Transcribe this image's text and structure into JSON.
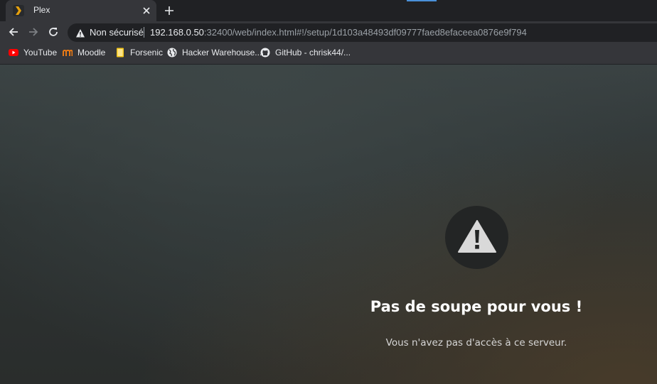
{
  "tab": {
    "title": "Plex",
    "favicon": "plex-chevron-icon",
    "favicon_color": "#e5a00d"
  },
  "toolbar": {
    "back": "back-arrow-icon",
    "forward": "forward-arrow-icon",
    "reload": "reload-icon"
  },
  "omnibox": {
    "security_label": "Non sécurisé",
    "url_host": "192.168.0.50",
    "url_path": ":32400/web/index.html#!/setup/1d103a48493df09777faed8efaceea0876e9f794"
  },
  "bookmarks": [
    {
      "label": "YouTube",
      "icon": "youtube-icon"
    },
    {
      "label": "Moodle",
      "icon": "moodle-icon"
    },
    {
      "label": "Forsenic",
      "icon": "folder-icon"
    },
    {
      "label": "Hacker Warehouse...",
      "icon": "globe-icon"
    },
    {
      "label": "GitHub - chrisk44/...",
      "icon": "github-icon"
    }
  ],
  "page": {
    "icon": "warning-icon",
    "headline": "Pas de soupe pour vous !",
    "message": "Vous n'avez pas d'accès à ce serveur."
  }
}
